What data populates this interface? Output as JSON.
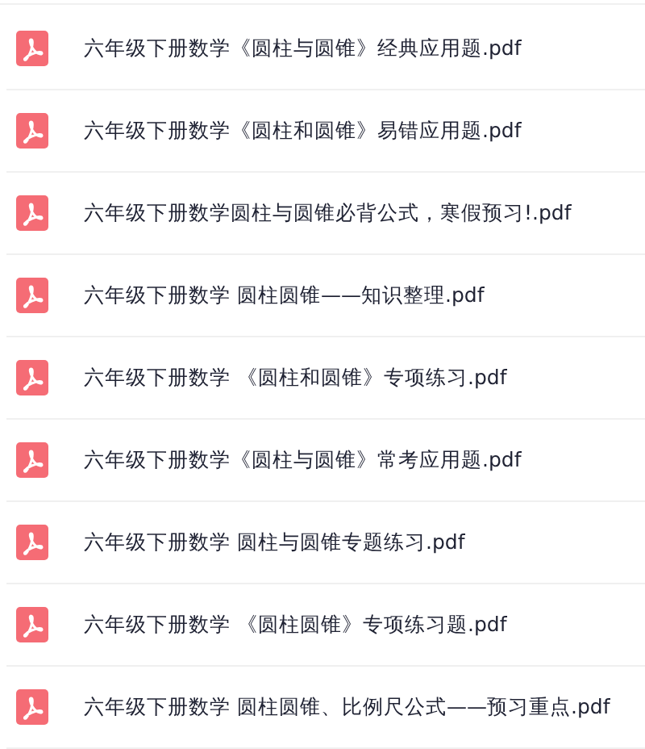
{
  "files": [
    {
      "name": "六年级下册数学《圆柱与圆锥》经典应用题.pdf"
    },
    {
      "name": "六年级下册数学《圆柱和圆锥》易错应用题.pdf"
    },
    {
      "name": "六年级下册数学圆柱与圆锥必背公式，寒假预习!.pdf"
    },
    {
      "name": "六年级下册数学 圆柱圆锥——知识整理.pdf"
    },
    {
      "name": "六年级下册数学 《圆柱和圆锥》专项练习.pdf"
    },
    {
      "name": "六年级下册数学《圆柱与圆锥》常考应用题.pdf"
    },
    {
      "name": "六年级下册数学 圆柱与圆锥专题练习.pdf"
    },
    {
      "name": "六年级下册数学 《圆柱圆锥》专项练习题.pdf"
    },
    {
      "name": "六年级下册数学 圆柱圆锥、比例尺公式——预习重点.pdf"
    }
  ]
}
